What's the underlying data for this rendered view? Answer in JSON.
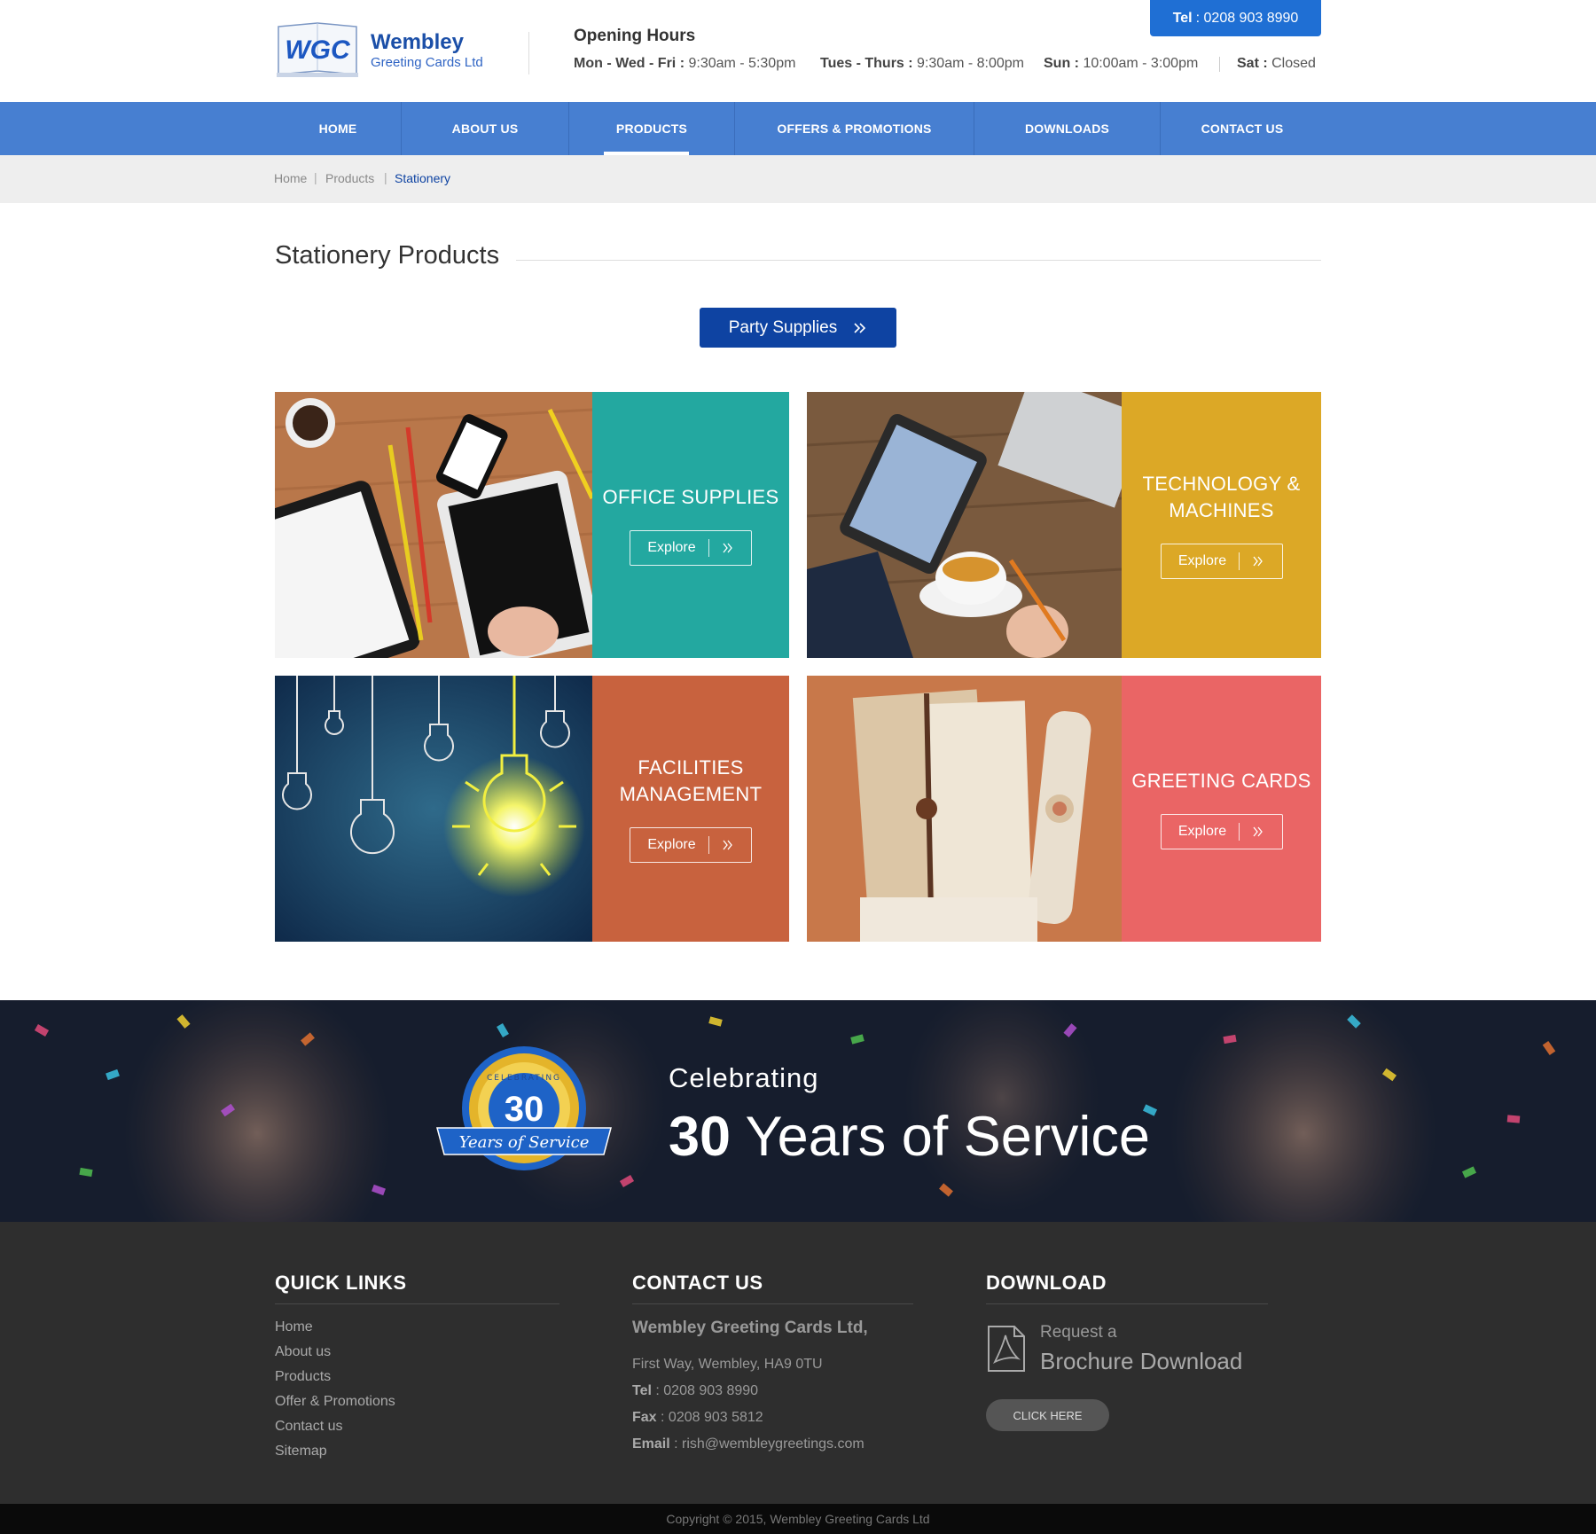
{
  "header": {
    "logo_mark": "WGC",
    "logo_title": "Wembley",
    "logo_subtitle": "Greeting Cards Ltd",
    "hours_title": "Opening Hours",
    "hours": [
      {
        "days": "Mon - Wed - Fri",
        "sep": " : ",
        "time": "9:30am - 5:30pm"
      },
      {
        "days": "Tues - Thurs",
        "sep": " : ",
        "time": "9:30am - 8:00pm"
      },
      {
        "days": "Sun",
        "sep": " : ",
        "time": "10:00am - 3:00pm"
      },
      {
        "days": "Sat",
        "sep": " : ",
        "time": "Closed"
      }
    ],
    "tel_label": "Tel",
    "tel_number": ": 0208 903 8990"
  },
  "nav": {
    "items": [
      {
        "label": "HOME"
      },
      {
        "label": "ABOUT US"
      },
      {
        "label": "PRODUCTS"
      },
      {
        "label": "OFFERS & PROMOTIONS"
      },
      {
        "label": "DOWNLOADS"
      },
      {
        "label": "CONTACT US"
      }
    ],
    "active": "PRODUCTS"
  },
  "breadcrumb": {
    "items": [
      "Home",
      "Products",
      "Stationery"
    ],
    "separator": "|"
  },
  "main": {
    "title": "Stationery Products",
    "party_button": "Party Supplies",
    "tiles": [
      {
        "label_lines": [
          "OFFICE SUPPLIES"
        ],
        "button": "Explore",
        "color": "#23a8a0"
      },
      {
        "label_lines": [
          "TECHNOLOGY &",
          "MACHINES"
        ],
        "button": "Explore",
        "color": "#dca826"
      },
      {
        "label_lines": [
          "FACILITIES",
          "MANAGEMENT"
        ],
        "button": "Explore",
        "color": "#c8623e"
      },
      {
        "label_lines": [
          "GREETING CARDS"
        ],
        "button": "Explore",
        "color": "#ea6565"
      }
    ]
  },
  "banner": {
    "badge_top": "CELEBRATING",
    "badge_number": "30",
    "badge_ribbon": "Years of Service",
    "small": "Celebrating",
    "big_number": "30",
    "big_text": " Years of Service"
  },
  "footer": {
    "quick_links_title": "QUICK LINKS",
    "quick_links": [
      "Home",
      "About us",
      "Products",
      "Offer & Promotions",
      "Contact us",
      "Sitemap"
    ],
    "contact_title": "CONTACT US",
    "company": "Wembley Greeting Cards Ltd,",
    "address": "First Way, Wembley, HA9 0TU",
    "contacts": [
      {
        "label": "Tel",
        "value": " : 0208 903 8990"
      },
      {
        "label": "Fax",
        "value": " : 0208 903 5812"
      },
      {
        "label": "Email",
        "value": " : rish@wembleygreetings.com"
      }
    ],
    "download_title": "DOWNLOAD",
    "download_small": "Request a",
    "download_big": "Brochure Download",
    "download_button": "CLICK HERE",
    "copyright": "Copyright © 2015, Wembley Greeting Cards Ltd"
  },
  "colors": {
    "brand_blue": "#1f6fd4",
    "nav_blue": "#477fd1",
    "dark_blue": "#0e43a2",
    "footer_bg": "#2e2e2e"
  }
}
